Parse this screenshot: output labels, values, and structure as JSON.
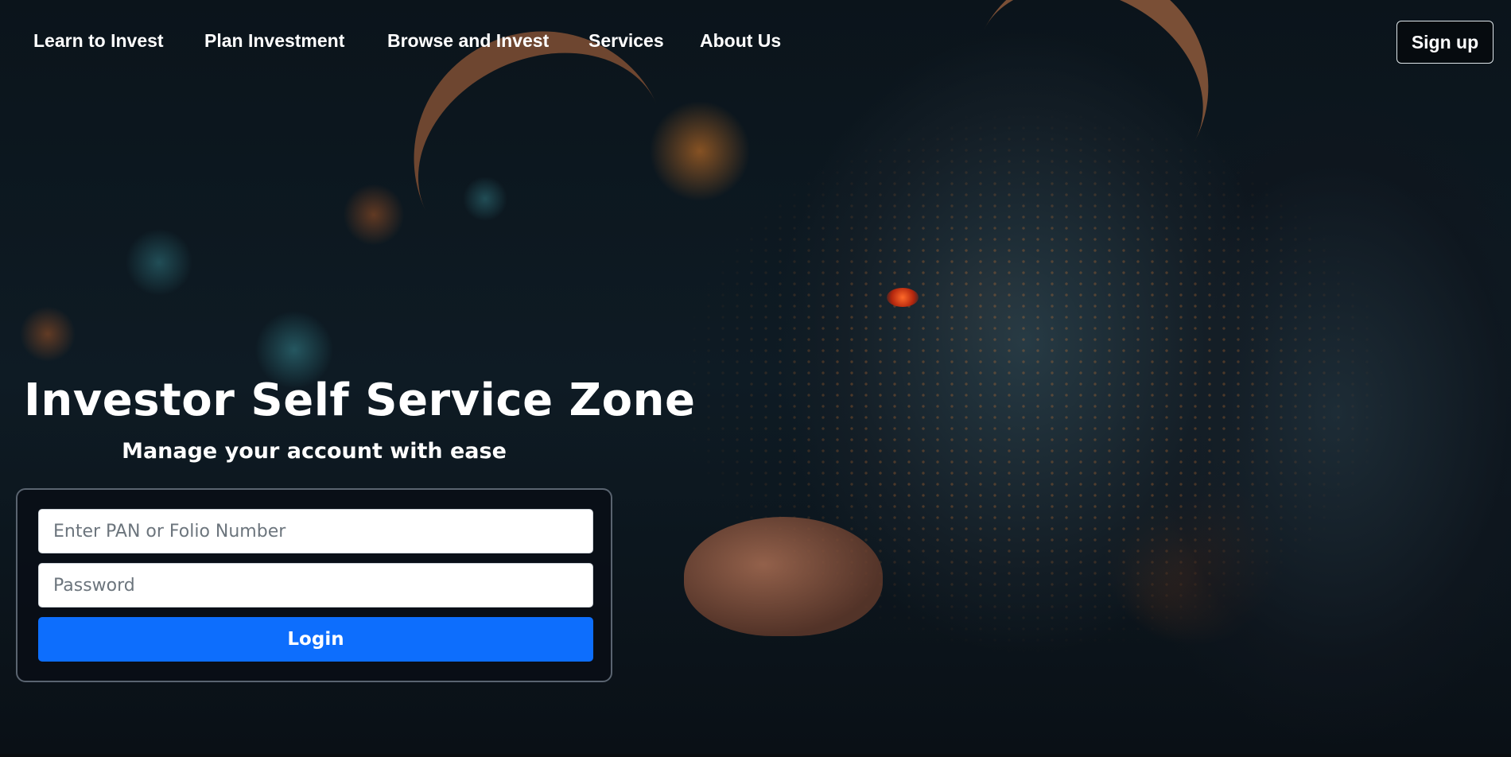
{
  "nav": {
    "items": [
      {
        "label": "Learn to Invest"
      },
      {
        "label": "Plan Investment"
      },
      {
        "label": "Browse and Invest"
      },
      {
        "label": "Services"
      },
      {
        "label": "About Us"
      }
    ],
    "signup_label": "Sign up"
  },
  "hero": {
    "title": "Investor Self Service Zone",
    "subtitle": "Manage your account with ease"
  },
  "login": {
    "pan_placeholder": "Enter PAN or Folio Number",
    "password_placeholder": "Password",
    "button_label": "Login"
  },
  "colors": {
    "primary_button": "#0d6efd",
    "card_border": "#5a6470"
  }
}
